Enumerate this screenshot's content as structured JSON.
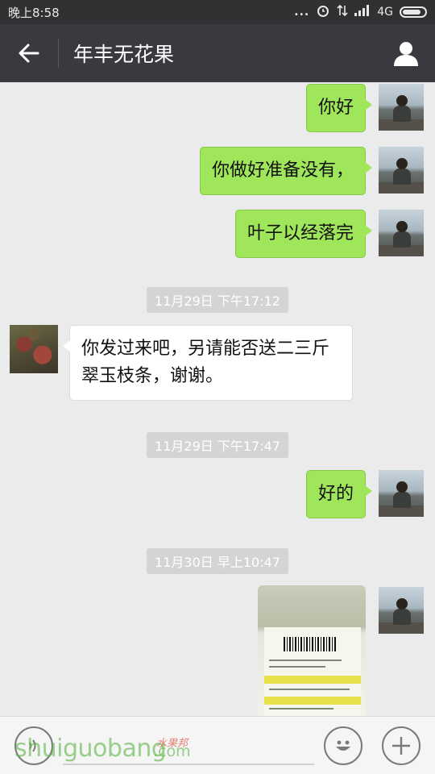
{
  "status_bar": {
    "time": "晚上8:58",
    "signal_dots": "...",
    "network": "4G"
  },
  "header": {
    "title": "年丰无花果"
  },
  "messages": [
    {
      "type": "out",
      "text": "你好"
    },
    {
      "type": "out",
      "text": "你做好准备没有，"
    },
    {
      "type": "out",
      "text": "叶子以经落完"
    },
    {
      "type": "time",
      "text": "11月29日 下午17:12"
    },
    {
      "type": "in",
      "text": "你发过来吧，另请能否送二三斤翠玉枝条，谢谢。"
    },
    {
      "type": "time",
      "text": "11月29日 下午17:47"
    },
    {
      "type": "out",
      "text": "好的"
    },
    {
      "type": "time",
      "text": "11月30日 早上10:47"
    },
    {
      "type": "out-image"
    }
  ],
  "input_bar": {
    "watermark": "shuiguobang",
    "watermark_suffix": ".com",
    "watermark_cn": "水果邦"
  },
  "icons": [
    "back-arrow-icon",
    "contact-icon",
    "voice-icon",
    "emoji-icon",
    "plus-icon",
    "alarm-icon",
    "signal-icon",
    "battery-icon"
  ]
}
